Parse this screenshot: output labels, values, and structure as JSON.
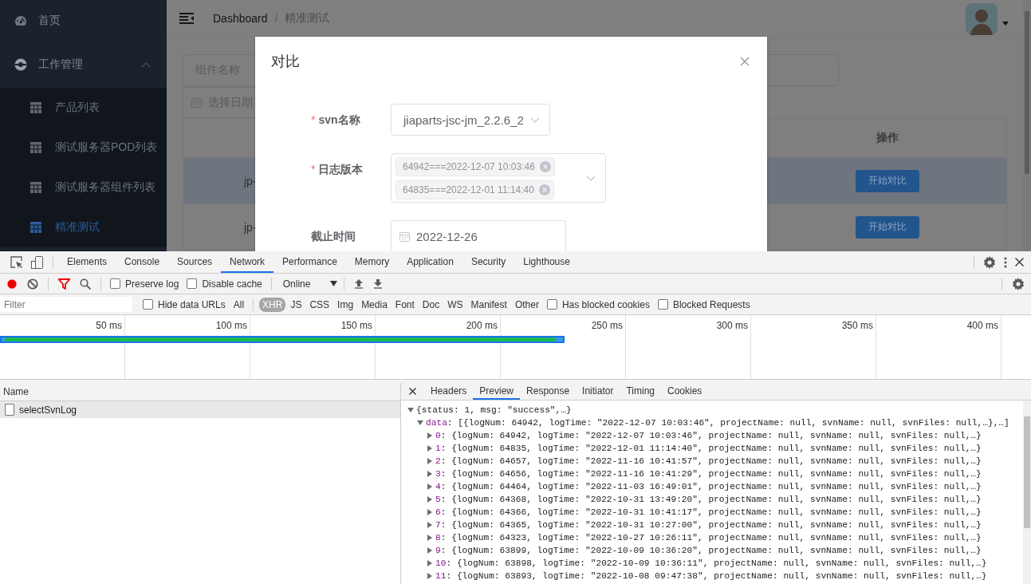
{
  "sidebar": {
    "items": [
      {
        "label": "首页",
        "kind": "link",
        "selected": false
      },
      {
        "label": "工作管理",
        "kind": "group",
        "selected": false,
        "expanded": true,
        "children": [
          {
            "label": "产品列表",
            "selected": false
          },
          {
            "label": "测试服务器POD列表",
            "selected": false
          },
          {
            "label": "测试服务器组件列表",
            "selected": false
          },
          {
            "label": "精准测试",
            "selected": true
          }
        ]
      }
    ]
  },
  "header": {
    "breadcrumb": [
      {
        "label": "Dashboard",
        "current": false
      },
      {
        "label": "精准测试",
        "current": true
      }
    ],
    "breadcrumb_separator": "/"
  },
  "filters": {
    "component_name": {
      "placeholder": "组件名称"
    },
    "date": {
      "placeholder": "选择日期"
    }
  },
  "table": {
    "action_header": "操作",
    "rows": [
      {
        "name": "jp-",
        "action": "开始对比",
        "selected": true
      },
      {
        "name": "jp-",
        "action": "开始对比",
        "selected": false
      }
    ]
  },
  "dialog": {
    "title": "对比",
    "required_mark": "*",
    "fields": [
      {
        "kind": "select",
        "label": "svn名称",
        "required": true,
        "value": "jiaparts-jsc-jm_2.2.6_2"
      },
      {
        "kind": "multiselect",
        "label": "日志版本",
        "required": true,
        "tags": [
          "64942===2022-12-07 10:03:46",
          "64835===2022-12-01 11:14:40"
        ]
      },
      {
        "kind": "date",
        "label": "截止时间",
        "required": false,
        "value": "2022-12-26"
      }
    ]
  },
  "devtools": {
    "tabs": [
      {
        "label": "Elements",
        "selected": false
      },
      {
        "label": "Console",
        "selected": false
      },
      {
        "label": "Sources",
        "selected": false
      },
      {
        "label": "Network",
        "selected": true
      },
      {
        "label": "Performance",
        "selected": false
      },
      {
        "label": "Memory",
        "selected": false
      },
      {
        "label": "Application",
        "selected": false
      },
      {
        "label": "Security",
        "selected": false
      },
      {
        "label": "Lighthouse",
        "selected": false
      }
    ],
    "toolbar": {
      "recording": true,
      "filter_active": true,
      "checkboxes": [
        {
          "label": "Preserve log",
          "checked": false
        },
        {
          "label": "Disable cache",
          "checked": false
        }
      ],
      "throttling": "Online"
    },
    "filter_bar": {
      "placeholder": "Filter",
      "hide_data_urls": {
        "label": "Hide data URLs",
        "checked": false
      },
      "types": [
        {
          "label": "All",
          "selected": false
        },
        {
          "label": "XHR",
          "selected": true
        },
        {
          "label": "JS",
          "selected": false
        },
        {
          "label": "CSS",
          "selected": false
        },
        {
          "label": "Img",
          "selected": false
        },
        {
          "label": "Media",
          "selected": false
        },
        {
          "label": "Font",
          "selected": false
        },
        {
          "label": "Doc",
          "selected": false
        },
        {
          "label": "WS",
          "selected": false
        },
        {
          "label": "Manifest",
          "selected": false
        },
        {
          "label": "Other",
          "selected": false
        }
      ],
      "options": [
        {
          "label": "Has blocked cookies",
          "checked": false
        },
        {
          "label": "Blocked Requests",
          "checked": false
        }
      ]
    },
    "timeline": {
      "ticks": [
        "50 ms",
        "100 ms",
        "150 ms",
        "200 ms",
        "250 ms",
        "300 ms",
        "350 ms",
        "400 ms"
      ]
    },
    "requests": {
      "header": "Name",
      "rows": [
        {
          "name": "selectSvnLog",
          "selected": true
        }
      ]
    },
    "detail_tabs": [
      {
        "label": "Headers",
        "selected": false
      },
      {
        "label": "Preview",
        "selected": true
      },
      {
        "label": "Response",
        "selected": false
      },
      {
        "label": "Initiator",
        "selected": false
      },
      {
        "label": "Timing",
        "selected": false
      },
      {
        "label": "Cookies",
        "selected": false
      }
    ],
    "preview_key_separator": ":",
    "preview": [
      {
        "text": "{status: 1, msg: \"success\",…}",
        "expanded": true,
        "children": [
          {
            "key": "data",
            "text": "[{logNum: 64942, logTime: \"2022-12-07 10:03:46\", projectName: null, svnName: null, svnFiles: null,…},…]",
            "expanded": true,
            "children": [
              {
                "key": "0",
                "text": "{logNum: 64942, logTime: \"2022-12-07 10:03:46\", projectName: null, svnName: null, svnFiles: null,…}",
                "expanded": false
              },
              {
                "key": "1",
                "text": "{logNum: 64835, logTime: \"2022-12-01 11:14:40\", projectName: null, svnName: null, svnFiles: null,…}",
                "expanded": false
              },
              {
                "key": "2",
                "text": "{logNum: 64657, logTime: \"2022-11-16 10:41:57\", projectName: null, svnName: null, svnFiles: null,…}",
                "expanded": false
              },
              {
                "key": "3",
                "text": "{logNum: 64656, logTime: \"2022-11-16 10:41:29\", projectName: null, svnName: null, svnFiles: null,…}",
                "expanded": false
              },
              {
                "key": "4",
                "text": "{logNum: 64464, logTime: \"2022-11-03 16:49:01\", projectName: null, svnName: null, svnFiles: null,…}",
                "expanded": false
              },
              {
                "key": "5",
                "text": "{logNum: 64368, logTime: \"2022-10-31 13:49:20\", projectName: null, svnName: null, svnFiles: null,…}",
                "expanded": false
              },
              {
                "key": "6",
                "text": "{logNum: 64366, logTime: \"2022-10-31 10:41:17\", projectName: null, svnName: null, svnFiles: null,…}",
                "expanded": false
              },
              {
                "key": "7",
                "text": "{logNum: 64365, logTime: \"2022-10-31 10:27:00\", projectName: null, svnName: null, svnFiles: null,…}",
                "expanded": false
              },
              {
                "key": "8",
                "text": "{logNum: 64323, logTime: \"2022-10-27 10:26:11\", projectName: null, svnName: null, svnFiles: null,…}",
                "expanded": false
              },
              {
                "key": "9",
                "text": "{logNum: 63899, logTime: \"2022-10-09 10:36:20\", projectName: null, svnName: null, svnFiles: null,…}",
                "expanded": false
              },
              {
                "key": "10",
                "text": "{logNum: 63898, logTime: \"2022-10-09 10:36:11\", projectName: null, svnName: null, svnFiles: null,…}",
                "expanded": false
              },
              {
                "key": "11",
                "text": "{logNum: 63893, logTime: \"2022-10-08 09:47:38\", projectName: null, svnName: null, svnFiles: null,…}",
                "expanded": false
              }
            ]
          }
        ]
      }
    ]
  }
}
